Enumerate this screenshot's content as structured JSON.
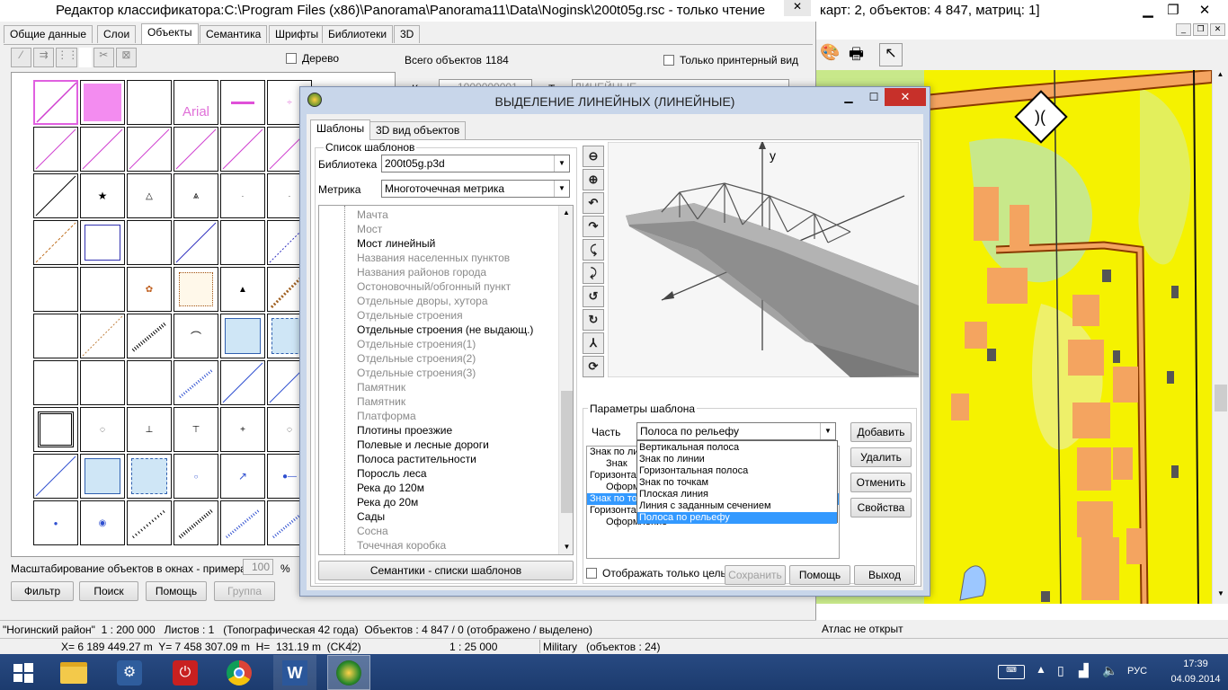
{
  "left_window": {
    "title": "Редактор классификатора:C:\\Program Files (x86)\\Panorama\\Panorama11\\Data\\Noginsk\\200t05g.rsc - только чтение",
    "tabs": [
      "Общие данные",
      "Слои",
      "Объекты",
      "Семантика",
      "Шрифты",
      "Библиотеки",
      "3D"
    ],
    "active_tab": 2,
    "tree_checkbox_label": "Дерево",
    "total_objects_label": "Всего объектов",
    "total_objects_value": "1184",
    "printer_view_label": "Только принтерный вид",
    "code_label": "Код",
    "code_value": "1000000001",
    "type_label": "Тип",
    "type_value": "ЛИНЕЙНЫЕ",
    "sample_text": "Arial",
    "scale_label": "Масштабирование объектов в окнах - примерах",
    "scale_value": "100",
    "scale_unit": "%",
    "buttons": {
      "filter": "Фильтр",
      "search": "Поиск",
      "help": "Помощь",
      "group": "Группа"
    }
  },
  "right_window": {
    "title_tail": "карт: 2, объектов: 4 847, матриц: 1]",
    "status": "Атлас не открыт"
  },
  "dialog": {
    "title": "ВЫДЕЛЕНИЕ ЛИНЕЙНЫХ (ЛИНЕЙНЫЕ)",
    "tabs": [
      "Шаблоны",
      "3D вид объектов"
    ],
    "group_label": "Список шаблонов",
    "library_label": "Библиотека",
    "library_value": "200t05g.p3d",
    "metric_label": "Метрика",
    "metric_value": "Многоточечная метрика",
    "templates": [
      {
        "label": "Мачта",
        "bold": false
      },
      {
        "label": "Мост",
        "bold": false
      },
      {
        "label": "Мост линейный",
        "bold": true
      },
      {
        "label": "Названия населенных пунктов",
        "bold": false
      },
      {
        "label": "Названия районов города",
        "bold": false
      },
      {
        "label": "Остоновочный/обгонный пункт",
        "bold": false
      },
      {
        "label": "Отдельные дворы, хутора",
        "bold": false
      },
      {
        "label": "Отдельные строения",
        "bold": false
      },
      {
        "label": "Отдельные строения (не выдающ.)",
        "bold": true
      },
      {
        "label": "Отдельные строения(1)",
        "bold": false
      },
      {
        "label": "Отдельные строения(2)",
        "bold": false
      },
      {
        "label": "Отдельные строения(3)",
        "bold": false
      },
      {
        "label": "Памятник",
        "bold": false
      },
      {
        "label": "Памятник",
        "bold": false
      },
      {
        "label": "Платформа",
        "bold": false
      },
      {
        "label": "Плотины проезжие",
        "bold": true
      },
      {
        "label": "Полевые и лесные дороги",
        "bold": true
      },
      {
        "label": "Полоса растительности",
        "bold": true
      },
      {
        "label": "Поросль леса",
        "bold": true
      },
      {
        "label": "Река до 120м",
        "bold": true
      },
      {
        "label": "Река до 20м",
        "bold": true
      },
      {
        "label": "Сады",
        "bold": true
      },
      {
        "label": "Сосна",
        "bold": false
      },
      {
        "label": "Точечная коробка",
        "bold": false
      }
    ],
    "semantics_button": "Семантики - списки шаблонов",
    "axis_y": "y",
    "params_label": "Параметры шаблона",
    "part_label": "Часть",
    "part_value": "Полоса по рельефу",
    "part_options": [
      "Вертикальная полоса",
      "Знак по линии",
      "Горизонтальная полоса",
      "Знак по точкам",
      "Плоская линия",
      "Линия с заданным сечением",
      "Полоса по рельефу"
    ],
    "part_selected": 6,
    "structure": [
      {
        "label": "Знак по линии",
        "indent": 0,
        "selected": false
      },
      {
        "label": "Знак",
        "indent": 1,
        "selected": false
      },
      {
        "label": "Горизонтальная полоса",
        "indent": 0,
        "selected": false
      },
      {
        "label": "Оформление",
        "indent": 1,
        "selected": false
      },
      {
        "label": "Знак по точкам",
        "indent": 0,
        "selected": true
      },
      {
        "label": "Горизонтальная полоса",
        "indent": 0,
        "selected": false
      },
      {
        "label": "Оформление",
        "indent": 1,
        "selected": false
      }
    ],
    "only_whole_label": "Отображать только целый объект",
    "side_buttons": {
      "add": "Добавить",
      "delete": "Удалить",
      "cancel": "Отменить",
      "props": "Свойства"
    },
    "bottom_buttons": {
      "save": "Сохранить",
      "help": "Помощь",
      "exit": "Выход"
    }
  },
  "statusbar": {
    "region": "\"Ногинский район\"  1 : 200 000   Листов : 1   (Топографическая 42 года)  Объектов : 4 847 / 0 (отображено / выделено)",
    "coords": "X= 6 189 449.27 m  Y= 7 458 307.09 m  H=  131.19 m  (CK42)",
    "scale": "1 : 25 000",
    "mode": "Military   (объектов : 24)"
  },
  "taskbar": {
    "lang": "РУС",
    "time": "17:39",
    "date": "04.09.2014"
  },
  "colors": {
    "map_yellow": "#f5f200",
    "map_orange": "#f4a460",
    "map_green": "#c8e88a",
    "dialog_frame": "#c8d6ea",
    "selection": "#3399ff",
    "taskbar": "#1c3b6e"
  }
}
